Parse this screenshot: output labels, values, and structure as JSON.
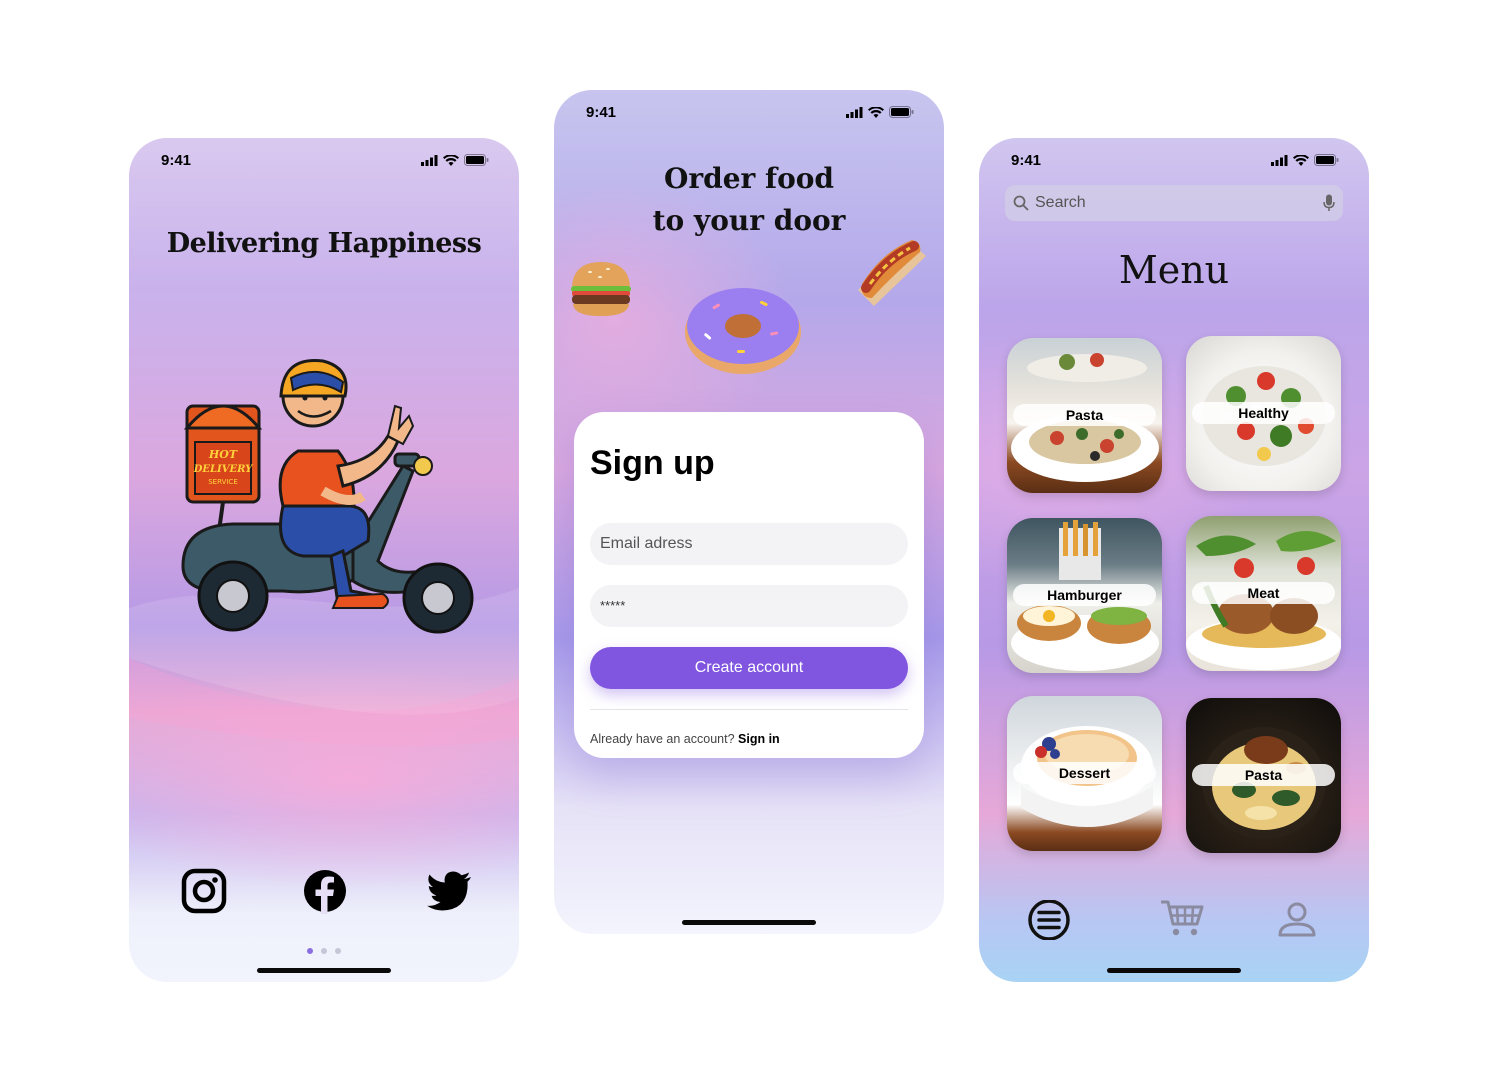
{
  "screens": {
    "welcome": {
      "time": "9:41",
      "title": "Delivering Happiness",
      "box_text_1": "HOT",
      "box_text_2": "DELIVERY",
      "box_text_3": "SERVICE",
      "social_icons": [
        "instagram-icon",
        "facebook-icon",
        "twitter-icon"
      ],
      "page_indicator": {
        "count": 3,
        "active": 1
      }
    },
    "signup": {
      "time": "9:41",
      "title_line1": "Order food",
      "title_line2": "to your door",
      "heading": "Sign up",
      "email_placeholder": "Email adress",
      "password_value": "*****",
      "create_button": "Create account",
      "have_account": "Already have an account?",
      "signin_link": "Sign in"
    },
    "menu": {
      "time": "9:41",
      "search_placeholder": "Search",
      "title": "Menu",
      "categories": [
        {
          "label": "Pasta"
        },
        {
          "label": "Healthy"
        },
        {
          "label": "Hamburger"
        },
        {
          "label": "Meat"
        },
        {
          "label": "Dessert"
        },
        {
          "label": "Pasta"
        }
      ],
      "tabbar_icons": [
        "menu-icon",
        "cart-icon",
        "profile-icon"
      ],
      "colors": {
        "accent": "#8055e0",
        "active_tab": "#111111",
        "inactive_tab": "#8a8aa0"
      }
    }
  }
}
